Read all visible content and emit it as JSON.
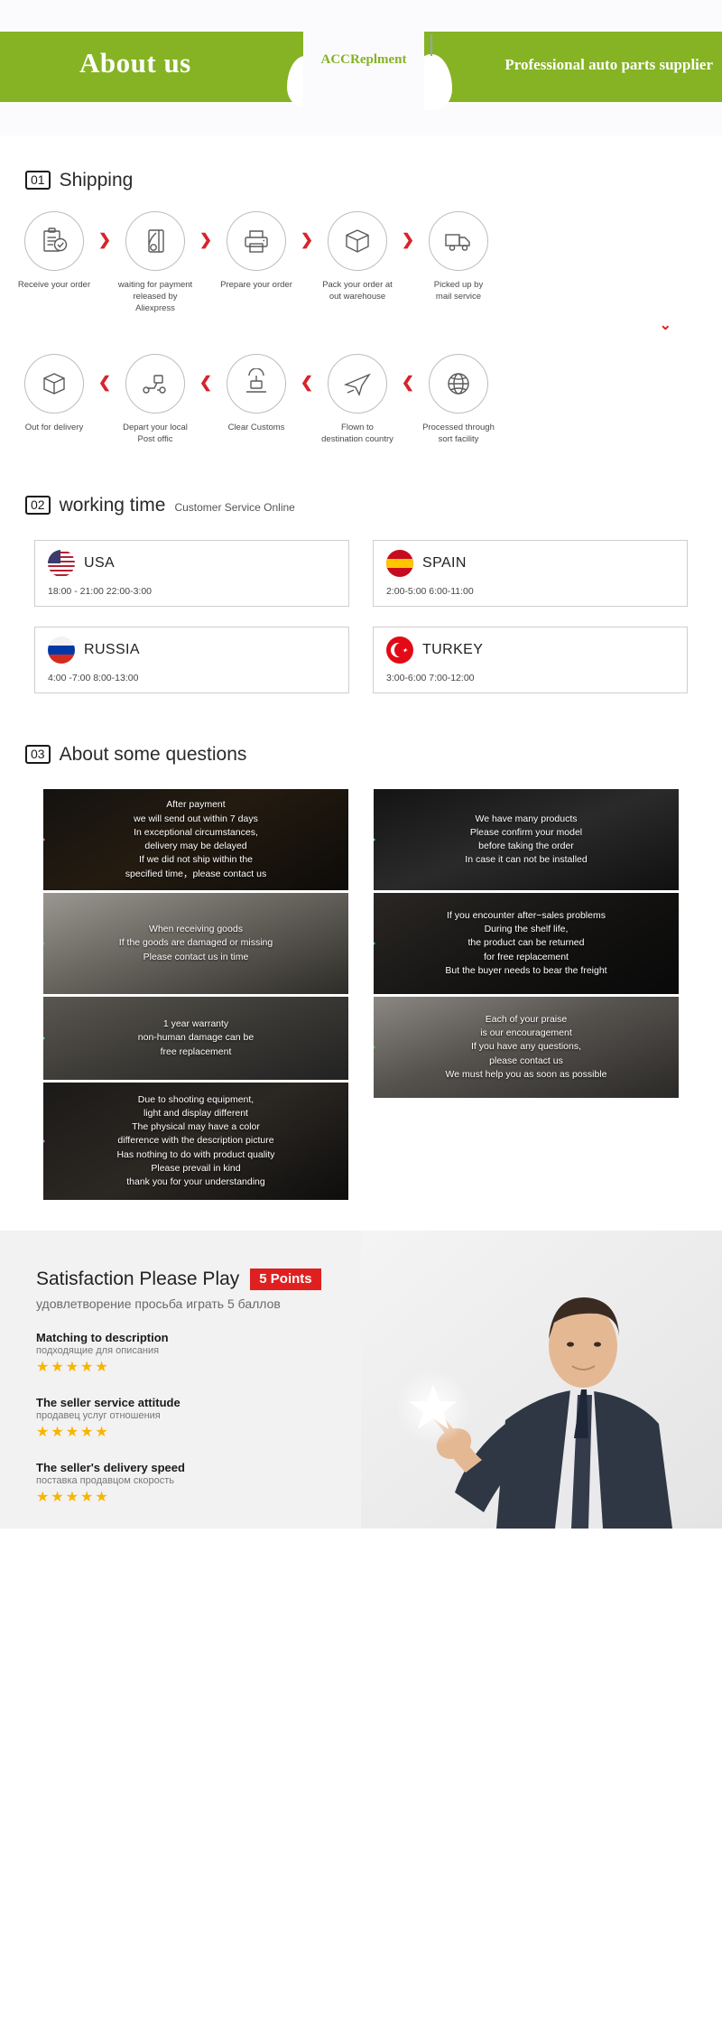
{
  "header": {
    "title": "About us",
    "subtitle": "Professional auto parts supplier",
    "logo": "ACCReplment",
    "brand_green": "#85b324"
  },
  "shipping": {
    "number": "01",
    "name": "Shipping",
    "row1": [
      {
        "icon": "clipboard-check-icon",
        "label": "Receive your order"
      },
      {
        "icon": "payment-card-icon",
        "label": "waiting for payment\nreleased by Aliexpress"
      },
      {
        "icon": "printer-icon",
        "label": "Prepare your order"
      },
      {
        "icon": "box-icon",
        "label": "Pack your order at\nout warehouse"
      },
      {
        "icon": "truck-icon",
        "label": "Picked up by\nmail service"
      }
    ],
    "row2": [
      {
        "icon": "open-box-icon",
        "label": "Out  for delivery"
      },
      {
        "icon": "scooter-delivery-icon",
        "label": "Depart your local\nPost offic"
      },
      {
        "icon": "customs-stamp-icon",
        "label": "Clear Customs"
      },
      {
        "icon": "airplane-icon",
        "label": "Flown to\ndestination country"
      },
      {
        "icon": "globe-icon",
        "label": "Processed through\nsort facility"
      }
    ],
    "arrow_right": "❯",
    "arrow_down": "⌄"
  },
  "working_time": {
    "number": "02",
    "name": "working time",
    "note": "Customer Service Online",
    "countries": [
      {
        "flag": "usa-flag-icon",
        "name": "USA",
        "hours": "18:00 - 21:00   22:00-3:00"
      },
      {
        "flag": "spain-flag-icon",
        "name": "SPAIN",
        "hours": "2:00-5:00     6:00-11:00"
      },
      {
        "flag": "russia-flag-icon",
        "name": "RUSSIA",
        "hours": "4:00 -7:00   8:00-13:00"
      },
      {
        "flag": "turkey-flag-icon",
        "name": "TURKEY",
        "hours": "3:00-6:00    7:00-12:00"
      }
    ]
  },
  "questions": {
    "number": "03",
    "name": "About some questions",
    "left": [
      {
        "accent": "#f4737d",
        "text": "After payment\nwe will send out within 7 days\nIn exceptional circumstances,\ndelivery may be delayed\nIf we did not ship within the\nspecified time，please contact us"
      },
      {
        "accent": "#3bb9c6",
        "text": "When receiving goods\nIf the goods are damaged or missing\nPlease contact us in time"
      },
      {
        "accent": "#3fd3a8",
        "text": "1 year warranty\nnon-human damage can be\nfree replacement"
      },
      {
        "accent": "#e95fd0",
        "text": "Due to shooting equipment,\nlight and display different\nThe physical may have a color\ndifference with the description picture\nHas nothing to do with product quality\nPlease prevail in kind\nthank you for your understanding"
      }
    ],
    "right": [
      {
        "accent": "#4fd6a0",
        "text": "We have many products\nPlease confirm your model\nbefore taking the order\nIn case it can not be installed"
      },
      {
        "accent": "#3bb9c6",
        "text": "If you encounter after−sales problems\nDuring the shelf life,\nthe product can be returned\nfor free replacement\nBut the buyer needs to bear the freight"
      },
      {
        "accent": "#4ec25a",
        "text": "Each of your praise\nis our encouragement\nIf you have any questions,\nplease contact us\nWe must help you as soon as possible"
      }
    ]
  },
  "satisfaction": {
    "title": "Satisfaction Please Play",
    "badge": "5 Points",
    "subtitle_ru": "удовлетворение просьба играть 5 баллов",
    "badge_color": "#e02020",
    "star_color": "#f7b500",
    "ratings": [
      {
        "en": "Matching to description",
        "ru": "подходящие для описания",
        "stars": "★★★★★"
      },
      {
        "en": "The seller service attitude",
        "ru": "продавец услуг отношения",
        "stars": "★★★★★"
      },
      {
        "en": "The seller's delivery speed",
        "ru": "поставка продавцом скорость",
        "stars": "★★★★★"
      }
    ]
  }
}
